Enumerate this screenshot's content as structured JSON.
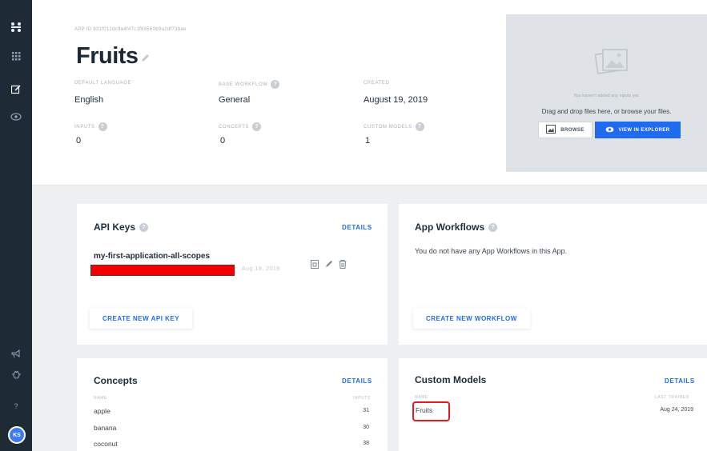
{
  "sidebar": {
    "icons": [
      "logo-icon",
      "apps-grid-icon",
      "edit-icon",
      "eye-icon",
      "megaphone-icon",
      "bug-icon",
      "help-icon"
    ],
    "help_label": "?",
    "avatar_initials": "KS"
  },
  "app": {
    "id_label": "APP ID 831f012dc9a4f47c1f69560b9a2df73bae",
    "title": "Fruits",
    "fields": {
      "default_language": {
        "label": "DEFAULT LANGUAGE",
        "value": "English"
      },
      "base_workflow": {
        "label": "BASE WORKFLOW",
        "value": "General"
      },
      "created": {
        "label": "CREATED",
        "value": "August 19, 2019"
      },
      "inputs": {
        "label": "INPUTS",
        "value": "0"
      },
      "concepts": {
        "label": "CONCEPTS",
        "value": "0"
      },
      "custom_models": {
        "label": "CUSTOM MODELS",
        "value": "1"
      }
    }
  },
  "dropzone": {
    "subtext": "You haven't added any inputs yet.",
    "main_text": "Drag and drop files here, or browse your files.",
    "browse_label": "BROWSE",
    "explorer_label": "VIEW IN EXPLORER"
  },
  "api_keys": {
    "title": "API Keys",
    "details_label": "DETAILS",
    "key_name": "my-first-application-all-scopes",
    "key_date": "Aug 19, 2019",
    "create_label": "CREATE NEW API KEY"
  },
  "workflows": {
    "title": "App Workflows",
    "empty_text": "You do not have any App Workflows in this App.",
    "create_label": "CREATE NEW WORKFLOW"
  },
  "concepts": {
    "title": "Concepts",
    "details_label": "DETAILS",
    "col_name": "NAME",
    "col_inputs": "INPUTS",
    "rows": [
      {
        "name": "apple",
        "inputs": "31"
      },
      {
        "name": "banana",
        "inputs": "30"
      },
      {
        "name": "coconut",
        "inputs": "38"
      }
    ]
  },
  "custom_models": {
    "title": "Custom Models",
    "details_label": "DETAILS",
    "col_name": "NAME",
    "col_trained": "LAST TRAINED",
    "rows": [
      {
        "name": "Fruits",
        "trained": "Aug 24, 2019"
      }
    ]
  },
  "colors": {
    "accent": "#1f6bf0",
    "sidebar": "#1e2a36",
    "highlight": "#e21c1c",
    "redaction": "#f00000"
  }
}
